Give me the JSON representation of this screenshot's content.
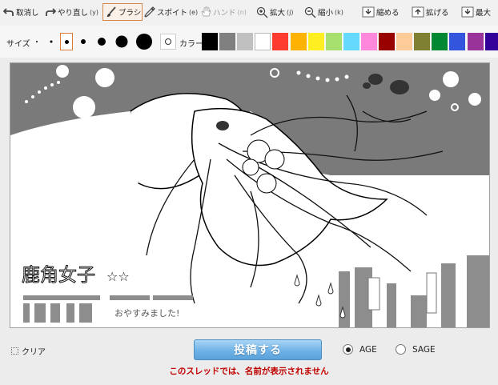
{
  "toolbar": {
    "undo": "取消し",
    "redo": "やり直し",
    "redo_key": "(y)",
    "brush": "ブラシ",
    "eyedropper": "スポイト",
    "eyedropper_key": "(e)",
    "hand": "ハンド",
    "hand_key": "(n)",
    "zoom_in": "拡大",
    "zoom_in_key": "(j)",
    "zoom_out": "縮小",
    "zoom_out_key": "(k)",
    "shrink": "縮める",
    "enlarge": "拡げる",
    "max": "最大"
  },
  "palette": {
    "size_label": "サイズ",
    "sizes": [
      "1",
      "2",
      "3",
      "4",
      "5",
      "6",
      "7"
    ],
    "selected_size": "3",
    "color_label": "カラー",
    "colors": [
      "#000000",
      "#808080",
      "#c0c0c0",
      "#ffffff",
      "#ff3b30",
      "#ffb300",
      "#ffee22",
      "#a8e070",
      "#66d9ff",
      "#ff88dd",
      "#990000",
      "#ffcc99",
      "#808033",
      "#008833",
      "#3355dd",
      "#993399",
      "#330099"
    ],
    "selected_color": "#000000"
  },
  "canvas": {
    "sign": "鹿角女子",
    "stars": "☆☆",
    "caption": "おやすみました!"
  },
  "footer": {
    "clear": "クリア",
    "post": "投稿する",
    "age": "AGE",
    "sage": "SAGE",
    "selected": "AGE",
    "warning": "このスレッドでは、名前が表示されません"
  },
  "accent": {
    "selection": "#e07a30",
    "post_button": "#6fb2e5",
    "warning": "#c00000"
  }
}
